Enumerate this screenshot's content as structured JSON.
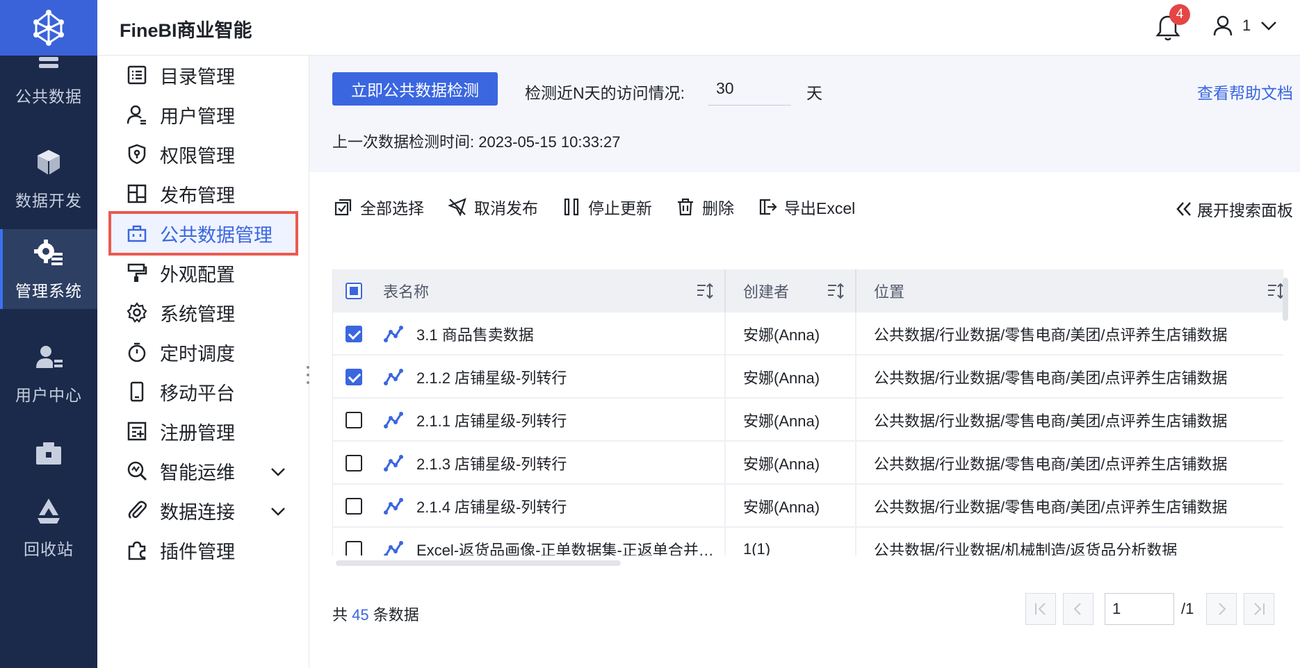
{
  "app": {
    "title": "FineBI商业智能"
  },
  "header": {
    "notification_count": "4",
    "user_name": "1"
  },
  "rail": {
    "items": [
      {
        "label": "公共数据",
        "icon": "database-icon"
      },
      {
        "label": "数据开发",
        "icon": "cube-icon"
      },
      {
        "label": "管理系统",
        "icon": "gear-icon",
        "active": true
      },
      {
        "label": "用户中心",
        "icon": "user-center-icon"
      },
      {
        "label": "",
        "icon": "toolbox-icon"
      },
      {
        "label": "回收站",
        "icon": "recycle-icon"
      }
    ]
  },
  "subnav": {
    "items": [
      {
        "label": "目录管理",
        "icon": "list-icon"
      },
      {
        "label": "用户管理",
        "icon": "user-icon"
      },
      {
        "label": "权限管理",
        "icon": "shield-icon"
      },
      {
        "label": "发布管理",
        "icon": "publish-icon"
      },
      {
        "label": "公共数据管理",
        "icon": "briefcase-icon",
        "active": true
      },
      {
        "label": "外观配置",
        "icon": "paint-roller-icon"
      },
      {
        "label": "系统管理",
        "icon": "settings-icon"
      },
      {
        "label": "定时调度",
        "icon": "timer-icon"
      },
      {
        "label": "移动平台",
        "icon": "mobile-icon"
      },
      {
        "label": "注册管理",
        "icon": "register-icon"
      },
      {
        "label": "智能运维",
        "icon": "ops-icon",
        "expandable": true
      },
      {
        "label": "数据连接",
        "icon": "paperclip-icon",
        "expandable": true
      },
      {
        "label": "插件管理",
        "icon": "puzzle-icon"
      }
    ]
  },
  "topbar": {
    "check_button": "立即公共数据检测",
    "days_label": "检测近N天的访问情况:",
    "days_value": "30",
    "days_unit": "天",
    "help_link": "查看帮助文档",
    "last_check": "上一次数据检测时间: 2023-05-15 10:33:27"
  },
  "toolbar": {
    "select_all": "全部选择",
    "unpublish": "取消发布",
    "stop_update": "停止更新",
    "delete": "删除",
    "export_excel": "导出Excel",
    "expand_search": "展开搜索面板"
  },
  "table": {
    "columns": [
      "表名称",
      "创建者",
      "位置"
    ],
    "rows": [
      {
        "checked": true,
        "name": "3.1 商品售卖数据",
        "creator": "安娜(Anna)",
        "location": "公共数据/行业数据/零售电商/美团/点评养生店铺数据"
      },
      {
        "checked": true,
        "name": "2.1.2 店铺星级-列转行",
        "creator": "安娜(Anna)",
        "location": "公共数据/行业数据/零售电商/美团/点评养生店铺数据"
      },
      {
        "checked": false,
        "name": "2.1.1 店铺星级-列转行",
        "creator": "安娜(Anna)",
        "location": "公共数据/行业数据/零售电商/美团/点评养生店铺数据"
      },
      {
        "checked": false,
        "name": "2.1.3 店铺星级-列转行",
        "creator": "安娜(Anna)",
        "location": "公共数据/行业数据/零售电商/美团/点评养生店铺数据"
      },
      {
        "checked": false,
        "name": "2.1.4 店铺星级-列转行",
        "creator": "安娜(Anna)",
        "location": "公共数据/行业数据/零售电商/美团/点评养生店铺数据"
      },
      {
        "checked": false,
        "name": "Excel-返货品画像-正单数据集-正返单合并数据",
        "creator": "1(1)",
        "location": "公共数据/行业数据/机械制造/返货品分析数据"
      }
    ]
  },
  "footer": {
    "count_prefix": "共",
    "count": "45",
    "count_suffix": "条数据",
    "current_page": "1",
    "total_pages": "/1"
  },
  "colors": {
    "accent": "#3a66e0",
    "rail_bg": "#1b2a4a",
    "logo_bg": "#3a63d9",
    "highlight": "#ea5a4f",
    "badge": "#e54545"
  }
}
